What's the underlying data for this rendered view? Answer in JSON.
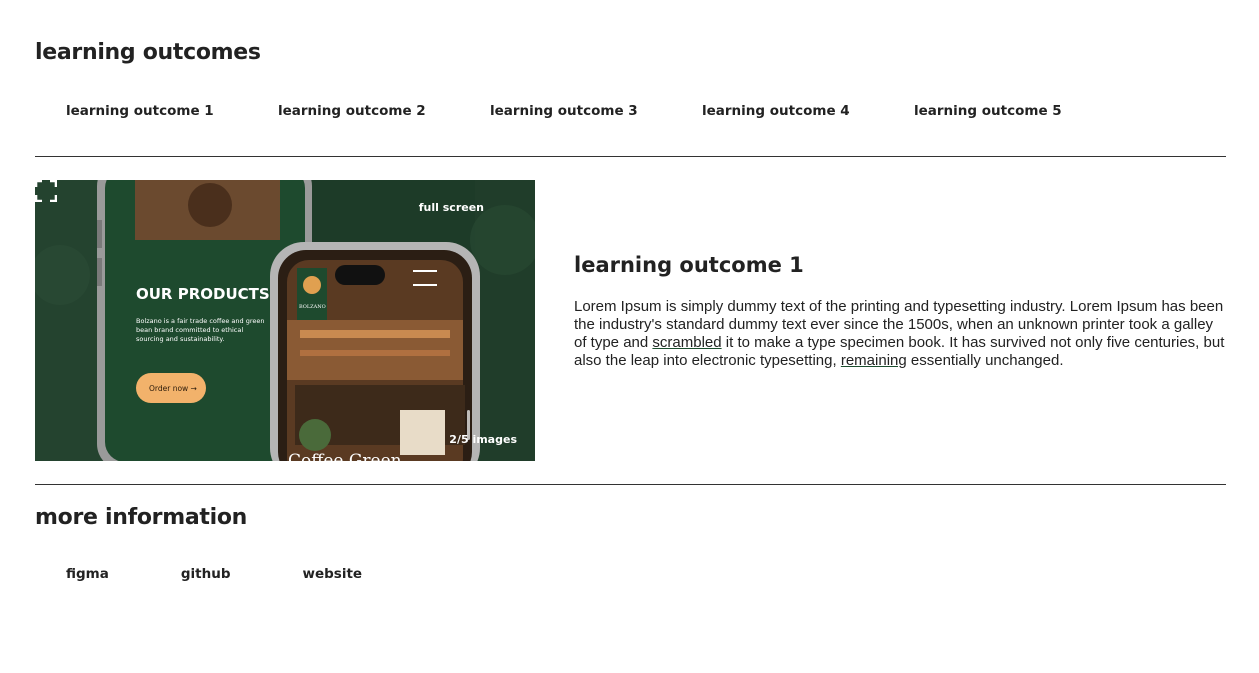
{
  "learning_outcomes": {
    "title": "learning outcomes",
    "tabs": [
      {
        "label": "learning outcome 1"
      },
      {
        "label": "learning outcome 2"
      },
      {
        "label": "learning outcome 3"
      },
      {
        "label": "learning outcome 4"
      },
      {
        "label": "learning outcome 5"
      }
    ]
  },
  "gallery": {
    "full_screen_label": "full screen",
    "counter": "2/5 images",
    "slide": {
      "heading": "OUR PRODUCTS",
      "body": "Bolzano is a fair trade coffee and green bean brand committed to ethical sourcing and sustainability.",
      "cta": "Order now →",
      "logo": "BOLZANO",
      "caption": "Coffee Green"
    }
  },
  "detail": {
    "title": "learning outcome 1",
    "text_1": "Lorem Ipsum is simply dummy text of the printing and typesetting industry. Lorem Ipsum has been the industry's standard dummy text ever since the 1500s, when an unknown printer took a galley of type and ",
    "link_1": "scrambled",
    "text_2": " it to make a type specimen book. It has survived not only five centuries, but also the leap into electronic typesetting, ",
    "link_2": "remaining",
    "text_3": " essentially unchanged."
  },
  "more_information": {
    "title": "more information",
    "links": [
      {
        "label": "figma"
      },
      {
        "label": "github"
      },
      {
        "label": "website"
      }
    ]
  },
  "colors": {
    "brand_green": "#1b4d2e",
    "cta_orange": "#f2b26b",
    "text": "#222222"
  }
}
